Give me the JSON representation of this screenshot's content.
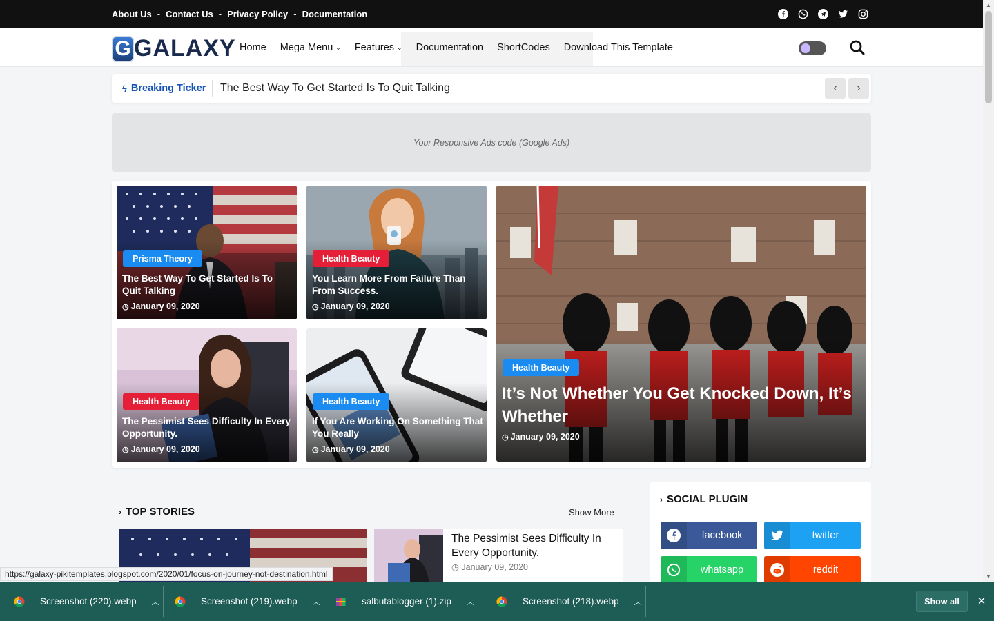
{
  "topbar": {
    "links": [
      "About Us",
      "Contact Us",
      "Privacy Policy",
      "Documentation"
    ],
    "separator": "-",
    "social_icons": [
      "facebook-icon",
      "whatsapp-icon",
      "telegram-icon",
      "twitter-icon",
      "instagram-icon"
    ]
  },
  "header": {
    "logo_letter": "G",
    "logo_text": "GALAXY",
    "nav": {
      "home": "Home",
      "mega_menu": "Mega Menu",
      "features": "Features",
      "documentation": "Documentation",
      "shortcodes": "ShortCodes",
      "download": "Download This Template"
    }
  },
  "ticker": {
    "label": "Breaking Ticker",
    "text": "The Best Way To Get Started Is To Quit Talking",
    "prev": "‹",
    "next": "›"
  },
  "ad": {
    "text": "Your Responsive Ads code (Google Ads)"
  },
  "featured": [
    {
      "tag": "Prisma Theory",
      "title": "The Best Way To Get Started Is To Quit Talking",
      "date": "January 09, 2020"
    },
    {
      "tag": "Health Beauty",
      "title": "You Learn More From Failure Than From Success.",
      "date": "January 09, 2020"
    },
    {
      "tag": "Health Beauty",
      "title": "It’s Not Whether You Get Knocked Down, It’s Whether",
      "date": "January 09, 2020"
    },
    {
      "tag": "Health Beauty",
      "title": "The Pessimist Sees Difficulty In Every Opportunity.",
      "date": "January 09, 2020"
    },
    {
      "tag": "Health Beauty",
      "title": "If You Are Working On Something That You Really",
      "date": "January 09, 2020"
    }
  ],
  "top_stories": {
    "heading": "TOP STORIES",
    "show_more": "Show More",
    "item": {
      "title": "The Pessimist Sees Difficulty In Every Opportunity.",
      "date": "January 09, 2020"
    }
  },
  "social_plugin": {
    "heading": "SOCIAL PLUGIN",
    "buttons": [
      {
        "label": "facebook",
        "color": "#3b5998"
      },
      {
        "label": "twitter",
        "color": "#1da1f2"
      },
      {
        "label": "whatsapp",
        "color": "#25d366"
      },
      {
        "label": "reddit",
        "color": "#ff4500"
      }
    ]
  },
  "status_url": "https://galaxy-pikitemplates.blogspot.com/2020/01/focus-on-journey-not-destination.html",
  "downloads": {
    "items": [
      "Screenshot (220).webp",
      "Screenshot (219).webp",
      "salbutablogger (1).zip",
      "Screenshot (218).webp"
    ],
    "show_all": "Show all"
  },
  "colors": {
    "accent_blue": "#1553b7",
    "tag_blue": "#1a8bf0",
    "tag_red": "#e41f37",
    "download_bar": "#1d5d56"
  }
}
